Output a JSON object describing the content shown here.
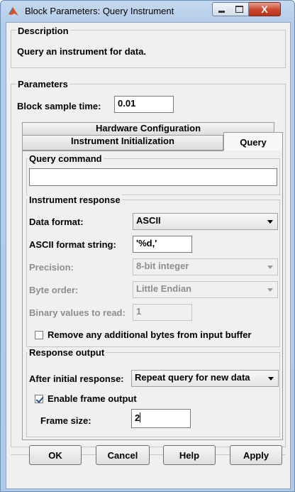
{
  "window": {
    "title": "Block Parameters: Query Instrument",
    "controls": [
      "minimize-icon",
      "maximize-icon",
      "close-icon"
    ]
  },
  "description": {
    "heading": "Description",
    "text": "Query an instrument for data."
  },
  "parameters": {
    "heading": "Parameters",
    "sample_time_label": "Block sample time:",
    "sample_time_value": "0.01"
  },
  "tabs": {
    "top": "Hardware Configuration",
    "init": "Instrument Initialization",
    "query": "Query"
  },
  "query_command": {
    "heading": "Query command",
    "value": ""
  },
  "instrument_response": {
    "heading": "Instrument response",
    "data_format_label": "Data format:",
    "data_format_value": "ASCII",
    "ascii_format_label": "ASCII format string:",
    "ascii_format_value": "'%d,'",
    "precision_label": "Precision:",
    "precision_value": "8-bit integer",
    "byte_order_label": "Byte order:",
    "byte_order_value": "Little Endian",
    "binary_values_label": "Binary values to read:",
    "binary_values_value": "1",
    "remove_bytes_label": "Remove any additional bytes from input buffer",
    "remove_bytes_checked": false
  },
  "response_output": {
    "heading": "Response output",
    "after_initial_label": "After initial response:",
    "after_initial_value": "Repeat query for new data",
    "enable_frame_label": "Enable frame output",
    "enable_frame_checked": true,
    "frame_size_label": "Frame size:",
    "frame_size_value": "2"
  },
  "buttons": {
    "ok": "OK",
    "cancel": "Cancel",
    "help": "Help",
    "apply": "Apply"
  },
  "colors": {
    "title_gradient": "#c5d9f0",
    "close_button": "#c9462c",
    "dialog_bg": "#f0f0f0"
  }
}
